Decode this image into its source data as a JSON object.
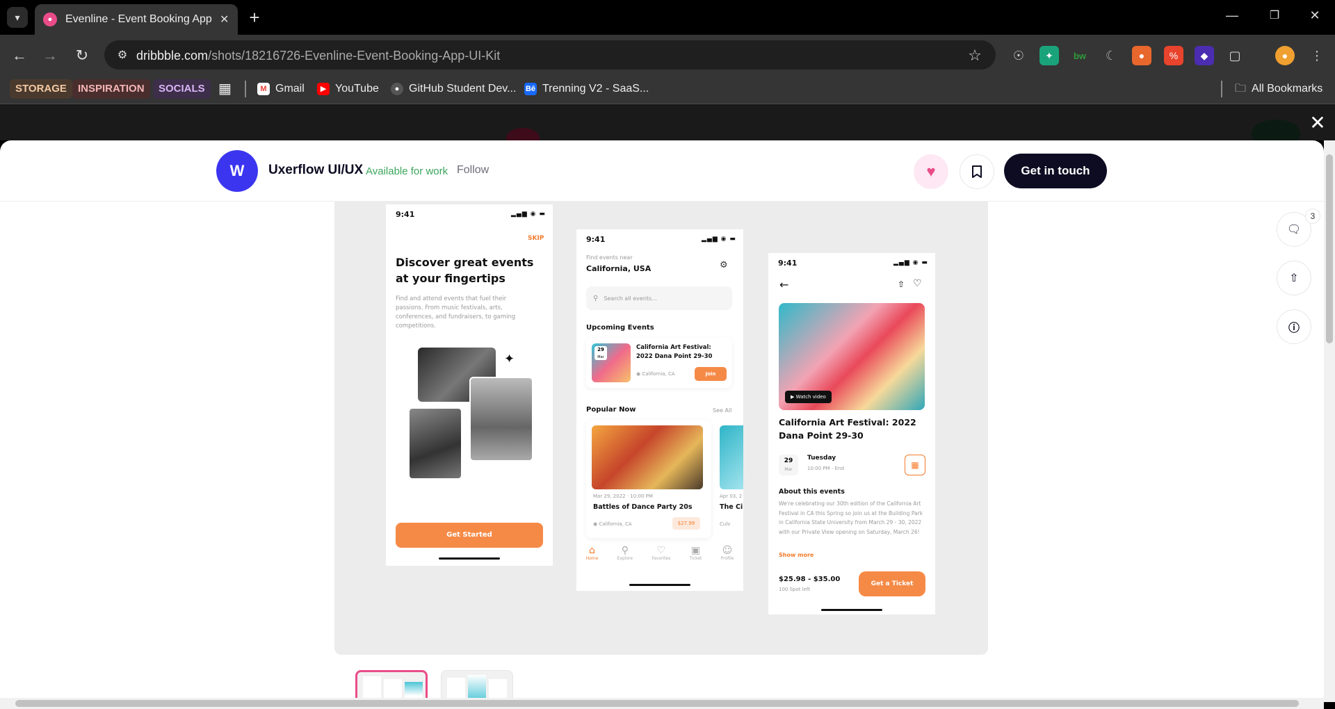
{
  "browser": {
    "tab_title": "Evenline - Event Booking App U",
    "url_host": "dribbble.com",
    "url_path": "/shots/18216726-Evenline-Event-Booking-App-UI-Kit",
    "bookmark_chips": [
      "STORAGE",
      "INSPIRATION",
      "SOCIALS"
    ],
    "bookmarks": [
      "Gmail",
      "YouTube",
      "GitHub Student Dev...",
      "Trenning V2 - SaaS..."
    ],
    "all_bookmarks": "All Bookmarks"
  },
  "header": {
    "designer": "Uxerflow UI/UX",
    "availability": "Available for work",
    "follow": "Follow",
    "cta": "Get in touch"
  },
  "sidebar": {
    "comment_count": "3"
  },
  "phone1": {
    "time": "9:41",
    "skip": "SKIP",
    "headline": "Discover great events at your fingertips",
    "body": "Find and attend events that fuel their passions. From music festivals, arts, conferences, and fundraisers, to gaming competitions.",
    "button": "Get Started"
  },
  "phone2": {
    "time": "9:41",
    "find_label": "Find events near",
    "location": "California, USA",
    "search_placeholder": "Search all events...",
    "upcoming_title": "Upcoming Events",
    "upcoming_day": "29",
    "upcoming_month": "Mar",
    "upcoming_name": "California Art Festival: 2022 Dana Point 29-30",
    "upcoming_place": "California, CA",
    "join": "Join",
    "popular_title": "Popular Now",
    "see_all": "See All",
    "popular_date": "Mar 29, 2022  ·  10:00 PM",
    "popular_name": "Battles of Dance Party 20s",
    "popular_place": "California, CA",
    "popular_price": "$27.99",
    "popular2_date": "Apr 03, 2",
    "popular2_name": "The Ci",
    "popular2_place": "Culv",
    "nav": [
      "Home",
      "Explore",
      "Favorites",
      "Ticket",
      "Profile"
    ]
  },
  "phone3": {
    "time": "9:41",
    "watch": "Watch video",
    "title": "California Art Festival: 2022 Dana Point 29-30",
    "day": "29",
    "month": "Mar",
    "weekday": "Tuesday",
    "hours": "10:00 PM - End",
    "about_title": "About this events",
    "about": "We're celebrating our 30th edition of the California Art Festival in CA this Spring so join us at the Building Park in California State University from March 29 - 30, 2022 with our Private View opening on Saturday, March 26!",
    "show_more": "Show more",
    "price": "$25.98 - $35.00",
    "spots": "100 Spot left",
    "ticket": "Get a Ticket"
  }
}
